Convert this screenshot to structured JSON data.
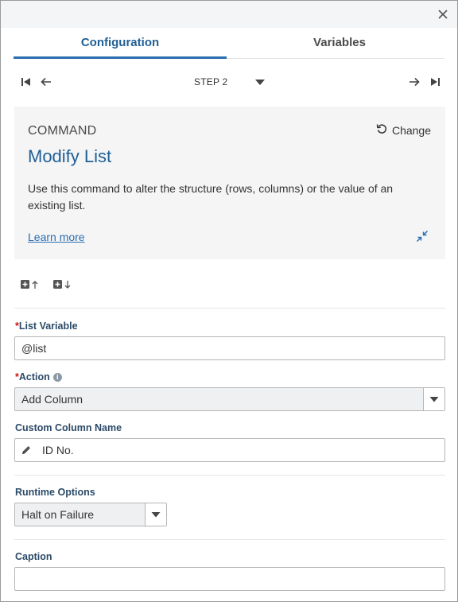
{
  "tabs": [
    {
      "label": "Configuration"
    },
    {
      "label": "Variables"
    }
  ],
  "step_nav": {
    "label": "STEP 2"
  },
  "command": {
    "kicker": "COMMAND",
    "change_label": "Change",
    "title": "Modify List",
    "description": "Use this command to alter the structure (rows, columns) or the value of an existing list.",
    "learn_more": "Learn more"
  },
  "fields": {
    "list_variable": {
      "label": "List Variable",
      "required_mark": "*",
      "value": "@list"
    },
    "action": {
      "label": "Action",
      "required_mark": "*",
      "info_glyph": "i",
      "value": "Add Column"
    },
    "custom_column_name": {
      "label": "Custom Column Name",
      "value": "ID No."
    },
    "runtime_options": {
      "label": "Runtime Options",
      "value": "Halt on Failure"
    },
    "caption": {
      "label": "Caption",
      "value": ""
    }
  },
  "colors": {
    "accent": "#2a6db0",
    "title": "#1f5f96",
    "required": "#d0121b"
  }
}
